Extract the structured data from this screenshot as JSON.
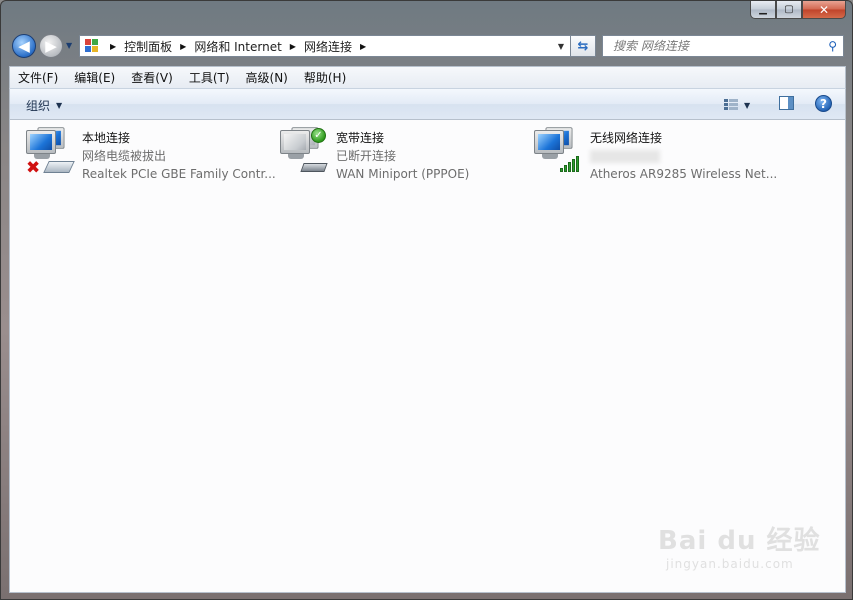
{
  "window": {
    "controls": {
      "minimize_icon": "minimize-icon",
      "maximize_icon": "maximize-icon",
      "close_label": "✕"
    }
  },
  "nav": {
    "breadcrumb": [
      "控制面板",
      "网络和 Internet",
      "网络连接"
    ],
    "search_placeholder": "搜索 网络连接",
    "icons": {
      "back": "back-arrow-icon",
      "forward": "forward-arrow-icon",
      "refresh": "refresh-icon",
      "search": "search-icon"
    }
  },
  "menu": {
    "items": [
      "文件(F)",
      "编辑(E)",
      "查看(V)",
      "工具(T)",
      "高级(N)",
      "帮助(H)"
    ]
  },
  "toolbar": {
    "organize_label": "组织",
    "icons": {
      "view": "change-view-icon",
      "preview_pane": "preview-pane-icon",
      "help": "help-icon"
    },
    "help_label": "?"
  },
  "connections": [
    {
      "name": "本地连接",
      "status": "网络电缆被拔出",
      "device": "Realtek PCIe GBE Family Contr...",
      "state_icon": "disconnected-x-icon"
    },
    {
      "name": "宽带连接",
      "status": "已断开连接",
      "device": "WAN Miniport (PPPOE)",
      "state_icon": "checkmark-icon"
    },
    {
      "name": "无线网络连接",
      "status": "",
      "device": "Atheros AR9285 Wireless Net...",
      "state_icon": "signal-bars-icon"
    }
  ],
  "watermark": {
    "brand": "Bai du 经验",
    "url": "jingyan.baidu.com"
  }
}
